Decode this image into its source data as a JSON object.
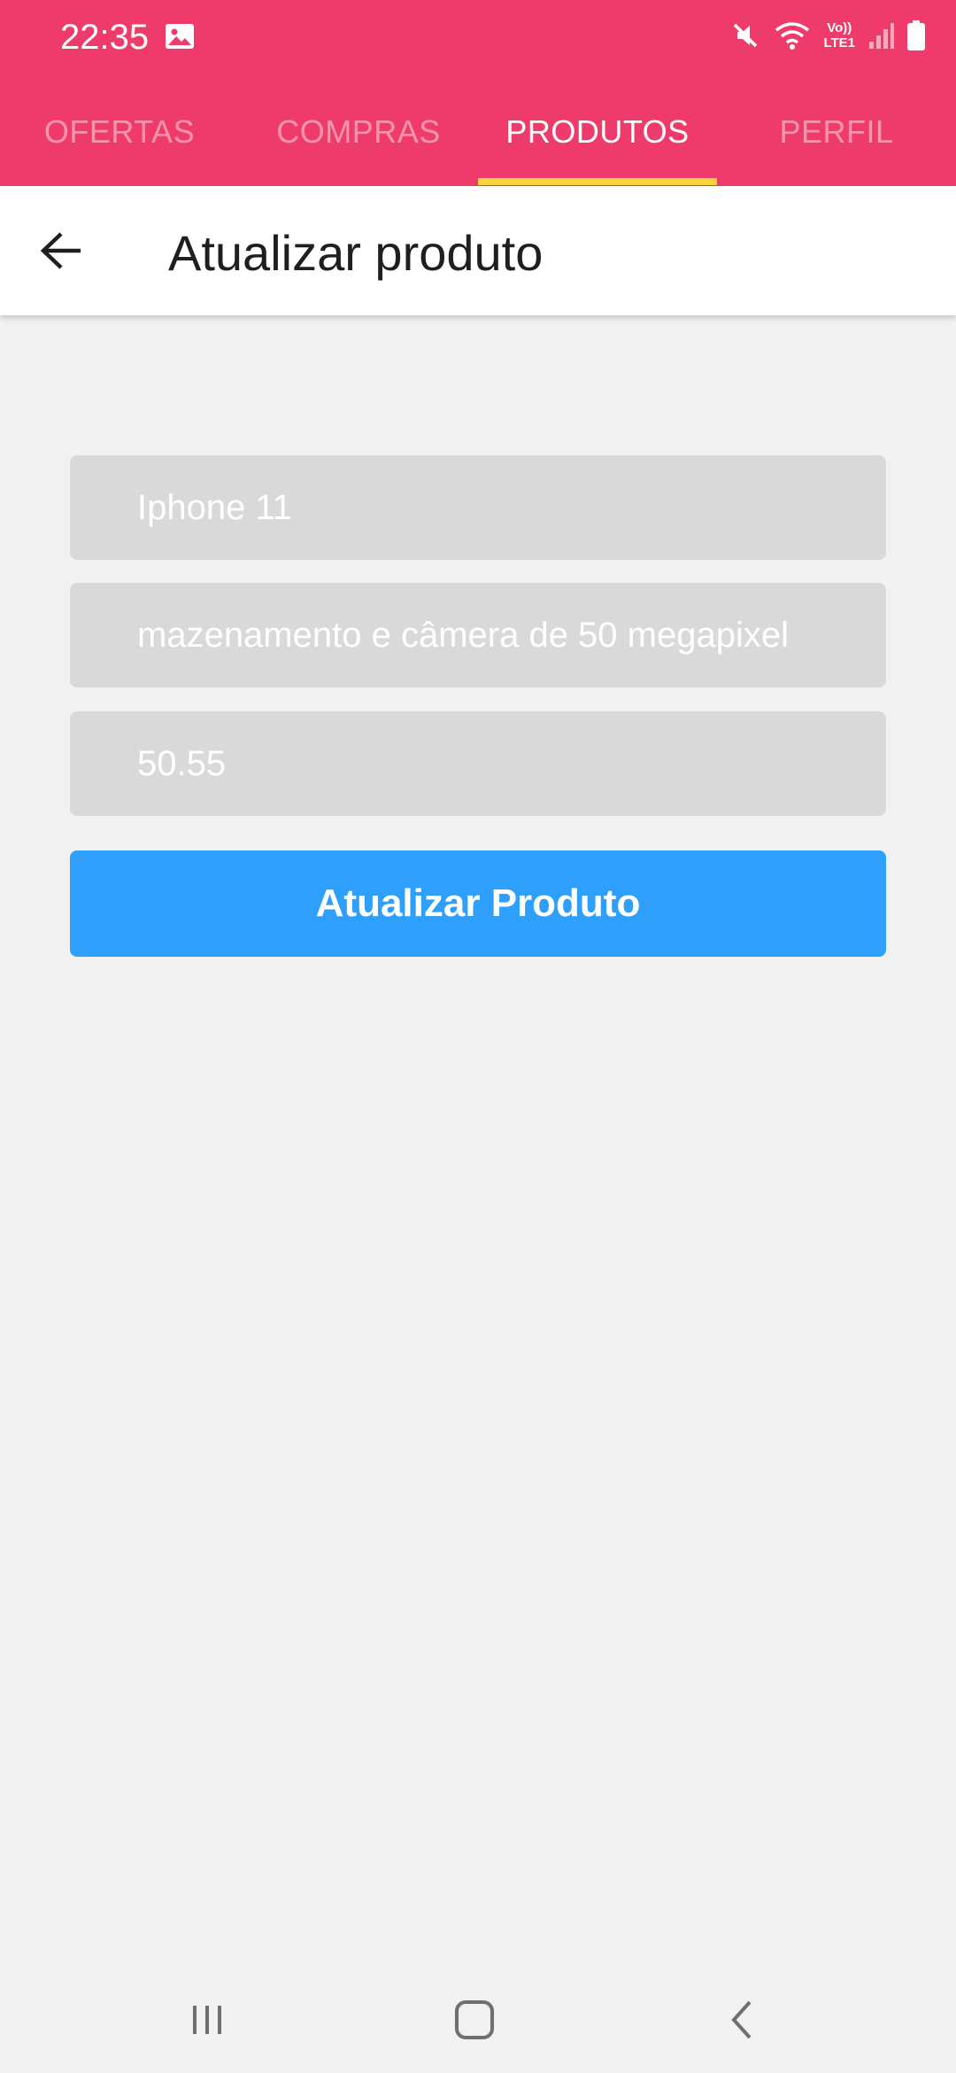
{
  "status_bar": {
    "time": "22:35",
    "icons": [
      "gallery-icon",
      "mute-icon",
      "wifi-icon",
      "volte-icon",
      "signal-icon",
      "battery-icon"
    ],
    "volte_line1": "Vo))",
    "volte_line2": "LTE1"
  },
  "tabs": [
    {
      "label": "OFERTAS",
      "active": false
    },
    {
      "label": "COMPRAS",
      "active": false
    },
    {
      "label": "PRODUTOS",
      "active": true
    },
    {
      "label": "PERFIL",
      "active": false
    }
  ],
  "toolbar": {
    "title": "Atualizar produto",
    "back_icon": "arrow-back-icon"
  },
  "form": {
    "name_value": "Iphone 11",
    "description_value": "mazenamento e câmera de 50 megapixel",
    "price_value": "50.55",
    "submit_label": "Atualizar Produto"
  },
  "nav_bar": {
    "icons": [
      "recents-icon",
      "home-icon",
      "back-icon"
    ]
  },
  "colors": {
    "app_bar": "#ef3b6b",
    "tab_indicator": "#f9d33e",
    "button": "#2f9ffc",
    "field_bg": "#d9d9d9",
    "background": "#f1f1f1"
  }
}
